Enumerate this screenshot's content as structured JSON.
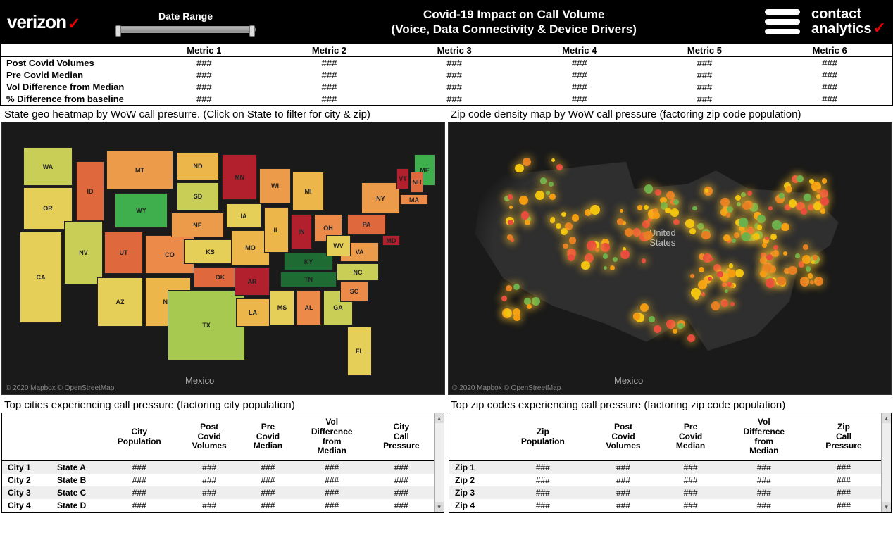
{
  "header": {
    "logo_left": "verizon",
    "date_range_label": "Date Range",
    "title_line1": "Covid-19 Impact on Call Volume",
    "title_line2": "(Voice, Data Connectivity & Device Drivers)",
    "logo_right_line1": "contact",
    "logo_right_line2": "analytics"
  },
  "metrics": {
    "columns": [
      "Metric 1",
      "Metric 2",
      "Metric 3",
      "Metric 4",
      "Metric 5",
      "Metric 6"
    ],
    "rows": [
      {
        "label": "Post Covid Volumes",
        "values": [
          "###",
          "###",
          "###",
          "###",
          "###",
          "###"
        ]
      },
      {
        "label": "Pre Covid Median",
        "values": [
          "###",
          "###",
          "###",
          "###",
          "###",
          "###"
        ]
      },
      {
        "label": "Vol Difference from Median",
        "values": [
          "###",
          "###",
          "###",
          "###",
          "###",
          "###"
        ]
      },
      {
        "label": "% Difference from baseline",
        "values": [
          "###",
          "###",
          "###",
          "###",
          "###",
          "###"
        ]
      }
    ]
  },
  "map_section": {
    "left_title": "State geo heatmap by WoW call presurre. (Click on State to filter for city & zip)",
    "right_title": "Zip code density map by WoW call pressure (factoring zip code population)",
    "attribution": "© 2020 Mapbox © OpenStreetMap",
    "mexico_label": "Mexico",
    "us_label": "United\nStates"
  },
  "chart_data": {
    "type": "heatmap",
    "note": "Choropleth of US states by week-over-week call pressure. Colors qualitative (green=low, yellow=mid, orange=high, red=very high). Numeric values masked as ### in source.",
    "states": [
      {
        "code": "WA",
        "color": "#c9cf56"
      },
      {
        "code": "OR",
        "color": "#e6cf58"
      },
      {
        "code": "CA",
        "color": "#e6cf58"
      },
      {
        "code": "NV",
        "color": "#c9cf56"
      },
      {
        "code": "ID",
        "color": "#e0683d"
      },
      {
        "code": "MT",
        "color": "#ec9b4a"
      },
      {
        "code": "WY",
        "color": "#3fae4d"
      },
      {
        "code": "UT",
        "color": "#e0683d"
      },
      {
        "code": "CO",
        "color": "#ec8a4a"
      },
      {
        "code": "AZ",
        "color": "#e6cf58"
      },
      {
        "code": "NM",
        "color": "#ecb64a"
      },
      {
        "code": "ND",
        "color": "#ecb64a"
      },
      {
        "code": "SD",
        "color": "#c9cf56"
      },
      {
        "code": "NE",
        "color": "#ec9b4a"
      },
      {
        "code": "KS",
        "color": "#e6cf58"
      },
      {
        "code": "OK",
        "color": "#e0683d"
      },
      {
        "code": "TX",
        "color": "#a8c94f"
      },
      {
        "code": "MN",
        "color": "#b21f2d"
      },
      {
        "code": "IA",
        "color": "#e6cf58"
      },
      {
        "code": "MO",
        "color": "#ecb64a"
      },
      {
        "code": "AR",
        "color": "#b21f2d"
      },
      {
        "code": "LA",
        "color": "#ecb64a"
      },
      {
        "code": "WI",
        "color": "#ec9b4a"
      },
      {
        "code": "IL",
        "color": "#ecb64a"
      },
      {
        "code": "MI",
        "color": "#ecb64a"
      },
      {
        "code": "IN",
        "color": "#b21f2d"
      },
      {
        "code": "OH",
        "color": "#ec8a4a"
      },
      {
        "code": "KY",
        "color": "#1f6b34"
      },
      {
        "code": "TN",
        "color": "#1f6b34"
      },
      {
        "code": "MS",
        "color": "#e6cf58"
      },
      {
        "code": "AL",
        "color": "#ec8a4a"
      },
      {
        "code": "GA",
        "color": "#c9cf56"
      },
      {
        "code": "FL",
        "color": "#e6cf58"
      },
      {
        "code": "SC",
        "color": "#ec8a4a"
      },
      {
        "code": "NC",
        "color": "#c9cf56"
      },
      {
        "code": "VA",
        "color": "#ec9b4a"
      },
      {
        "code": "WV",
        "color": "#e6cf58"
      },
      {
        "code": "PA",
        "color": "#e0683d"
      },
      {
        "code": "NY",
        "color": "#ec9b4a"
      },
      {
        "code": "ME",
        "color": "#3fae4d"
      },
      {
        "code": "VT",
        "color": "#b21f2d"
      },
      {
        "code": "NH",
        "color": "#e0683d"
      },
      {
        "code": "MA",
        "color": "#ec8a4a"
      },
      {
        "code": "MD",
        "color": "#b21f2d"
      }
    ]
  },
  "bottom": {
    "left_title": "Top cities experiencing call pressure (factoring city population)",
    "right_title": "Top zip codes experiencing call pressure (factoring zip code population)",
    "city_table": {
      "headers": [
        "",
        "",
        "City Population",
        "Post Covid Volumes",
        "Pre Covid Median",
        "Vol Difference from Median",
        "City Call Pressure"
      ],
      "rows": [
        {
          "c1": "City 1",
          "c2": "State A",
          "vals": [
            "###",
            "###",
            "###",
            "###",
            "###"
          ]
        },
        {
          "c1": "City 2",
          "c2": "State B",
          "vals": [
            "###",
            "###",
            "###",
            "###",
            "###"
          ]
        },
        {
          "c1": "City 3",
          "c2": "State C",
          "vals": [
            "###",
            "###",
            "###",
            "###",
            "###"
          ]
        },
        {
          "c1": "City 4",
          "c2": "State D",
          "vals": [
            "###",
            "###",
            "###",
            "###",
            "###"
          ]
        }
      ]
    },
    "zip_table": {
      "headers": [
        "",
        "Zip Population",
        "Post Covid Volumes",
        "Pre Covid Median",
        "Vol Difference from Median",
        "Zip Call Pressure"
      ],
      "rows": [
        {
          "c1": "Zip 1",
          "vals": [
            "###",
            "###",
            "###",
            "###",
            "###"
          ]
        },
        {
          "c1": "Zip 2",
          "vals": [
            "###",
            "###",
            "###",
            "###",
            "###"
          ]
        },
        {
          "c1": "Zip 3",
          "vals": [
            "###",
            "###",
            "###",
            "###",
            "###"
          ]
        },
        {
          "c1": "Zip 4",
          "vals": [
            "###",
            "###",
            "###",
            "###",
            "###"
          ]
        }
      ]
    }
  }
}
